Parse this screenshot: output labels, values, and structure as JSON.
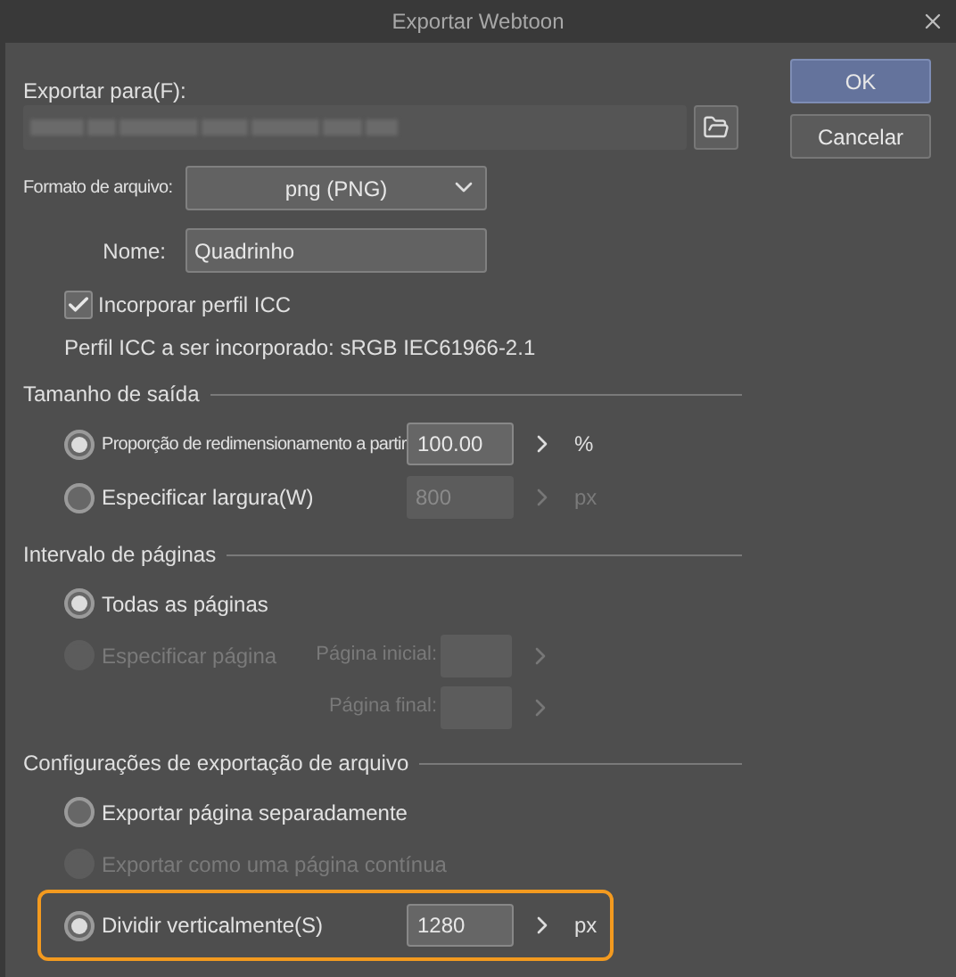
{
  "window": {
    "title": "Exportar Webtoon"
  },
  "buttons": [
    {
      "label": "OK",
      "kind": "primary"
    },
    {
      "label": "Cancelar",
      "kind": "normal"
    }
  ],
  "export_to": {
    "label": "Exportar para(F):"
  },
  "file_format": {
    "label": "Formato de arquivo:",
    "value": "png (PNG)"
  },
  "name": {
    "label": "Nome:",
    "value": "Quadrinho"
  },
  "embed_icc": {
    "label": "Incorporar perfil ICC",
    "checked": true
  },
  "icc_profile_note": "Perfil ICC a ser incorporado: sRGB IEC61966-2.1",
  "sections": [
    {
      "title": "Tamanho de saída",
      "options": [
        {
          "label": "Proporção de redimensionamento a partir",
          "selected": true,
          "disabled": false,
          "highlighted": false,
          "small": true,
          "fields": [
            {
              "value": "100.00",
              "unit": "%",
              "disabled": false
            }
          ]
        },
        {
          "label": "Especificar largura(W)",
          "selected": false,
          "disabled": false,
          "highlighted": false,
          "small": false,
          "fields": [
            {
              "value": "800",
              "unit": "px",
              "disabled": true
            }
          ]
        }
      ]
    },
    {
      "title": "Intervalo de páginas",
      "options": [
        {
          "label": "Todas as páginas",
          "selected": true,
          "disabled": false,
          "highlighted": false,
          "small": false
        },
        {
          "label": "Especificar página",
          "selected": false,
          "disabled": true,
          "highlighted": false,
          "small": false,
          "fields": [
            {
              "label": "Página inicial:",
              "disabled": true
            },
            {
              "label": "Página final:",
              "disabled": true
            }
          ]
        }
      ]
    },
    {
      "title": "Configurações de exportação de arquivo",
      "options": [
        {
          "label": "Exportar página separadamente",
          "selected": false,
          "disabled": false,
          "highlighted": false,
          "small": false
        },
        {
          "label": "Exportar como uma página contínua",
          "selected": false,
          "disabled": true,
          "highlighted": false,
          "small": false
        },
        {
          "label": "Dividir verticalmente(S)",
          "selected": true,
          "disabled": false,
          "highlighted": true,
          "small": false,
          "fields": [
            {
              "value": "1280",
              "unit": "px",
              "disabled": false
            }
          ]
        }
      ]
    }
  ]
}
